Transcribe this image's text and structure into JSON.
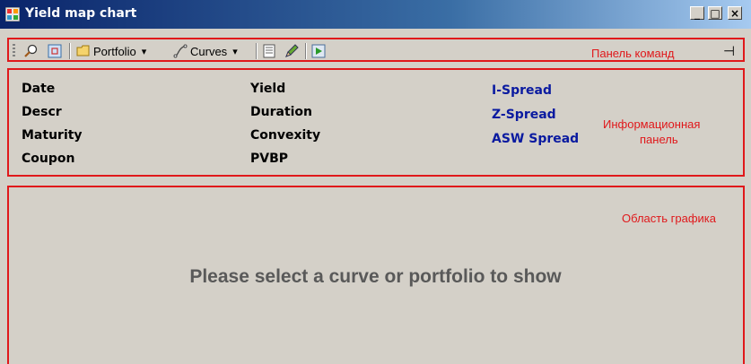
{
  "window": {
    "title": "Yield map chart",
    "minimize": "_",
    "maximize": "□",
    "close": "×"
  },
  "toolbar": {
    "portfolio_label": "Portfolio",
    "curves_label": "Curves",
    "dropdown_arrow": "▾",
    "pin": "⊣"
  },
  "annotations": {
    "command_panel": "Панель команд",
    "info_panel_line1": "Информационная",
    "info_panel_line2": "панель",
    "chart_area": "Область графика"
  },
  "info": {
    "col1": [
      "Date",
      "Descr",
      "Maturity",
      "Coupon"
    ],
    "col2": [
      "Yield",
      "Duration",
      "Convexity",
      "PVBP"
    ],
    "col3": [
      "I-Spread",
      "Z-Spread",
      "ASW Spread"
    ]
  },
  "chart": {
    "placeholder": "Please select a curve or portfolio to show"
  },
  "colors": {
    "annotation": "#e0181b",
    "spread_fields": "#0a1aa0",
    "title_bar": "#0a246a"
  }
}
